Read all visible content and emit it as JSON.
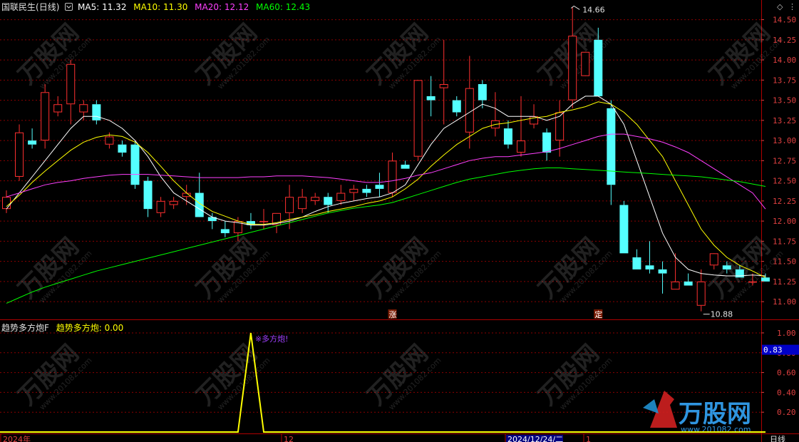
{
  "main_panel": {
    "stock_name": "国联民生",
    "period": "(日线)",
    "ma_legend": [
      {
        "label": "MA5: 11.32",
        "color": "#ffffff"
      },
      {
        "label": "MA10: 11.30",
        "color": "#ffff00"
      },
      {
        "label": "MA20: 12.12",
        "color": "#ff40ff"
      },
      {
        "label": "MA60: 12.43",
        "color": "#00ff00"
      }
    ],
    "high_marker": "14.66",
    "low_marker": "10.88",
    "markers": [
      {
        "text": "涨",
        "index": 30
      },
      {
        "text": "定",
        "index": 46
      }
    ],
    "colors": {
      "up": "#ff3030",
      "down": "#54ffff",
      "grid": "#8b0000",
      "axis_text": "#e04040"
    }
  },
  "sub_panel": {
    "name": "趋势多方炮F",
    "value_label": "趋势多方炮: 0.00",
    "signal_text": "※多方炮!",
    "current_marker": "0.83",
    "color": "#ffff00"
  },
  "x_axis": {
    "labels": [
      "2024年",
      "12",
      "2024/12/24/二",
      "1"
    ],
    "period_label": "日线"
  },
  "watermark": {
    "brand": "万股网",
    "url": "www.201082.com"
  },
  "chart_data": [
    {
      "type": "candlestick",
      "title": "国联民生 (日线)",
      "ylim": [
        10.78,
        14.62
      ],
      "y_ticks": [
        11.0,
        11.25,
        11.5,
        11.75,
        12.0,
        12.25,
        12.5,
        12.75,
        13.0,
        13.25,
        13.5,
        13.75,
        14.0,
        14.25,
        14.5
      ],
      "candles": [
        [
          12.15,
          12.38,
          12.1,
          12.3
        ],
        [
          12.55,
          13.2,
          12.5,
          13.1
        ],
        [
          13.0,
          13.15,
          12.9,
          12.95
        ],
        [
          13.0,
          13.7,
          12.9,
          13.6
        ],
        [
          13.35,
          13.55,
          13.3,
          13.45
        ],
        [
          13.45,
          14.0,
          13.2,
          13.95
        ],
        [
          13.35,
          13.5,
          13.25,
          13.45
        ],
        [
          13.45,
          13.5,
          13.2,
          13.25
        ],
        [
          12.95,
          13.1,
          12.9,
          13.05
        ],
        [
          12.95,
          13.0,
          12.8,
          12.85
        ],
        [
          12.95,
          13.0,
          12.4,
          12.45
        ],
        [
          12.5,
          12.55,
          12.05,
          12.15
        ],
        [
          12.1,
          12.3,
          12.05,
          12.25
        ],
        [
          12.2,
          12.3,
          12.15,
          12.25
        ],
        [
          12.3,
          12.45,
          12.2,
          12.35
        ],
        [
          12.35,
          12.6,
          12.15,
          12.05
        ],
        [
          12.05,
          12.1,
          11.9,
          12.0
        ],
        [
          11.9,
          12.0,
          11.8,
          11.85
        ],
        [
          11.85,
          12.05,
          11.75,
          12.0
        ],
        [
          12.0,
          12.1,
          11.9,
          11.95
        ],
        [
          12.0,
          12.15,
          11.9,
          12.0
        ],
        [
          11.95,
          12.1,
          11.85,
          12.1
        ],
        [
          12.1,
          12.45,
          11.9,
          12.3
        ],
        [
          12.15,
          12.4,
          12.1,
          12.3
        ],
        [
          12.25,
          12.35,
          12.2,
          12.3
        ],
        [
          12.3,
          12.35,
          12.1,
          12.2
        ],
        [
          12.25,
          12.45,
          12.2,
          12.35
        ],
        [
          12.35,
          12.45,
          12.25,
          12.4
        ],
        [
          12.4,
          12.45,
          12.3,
          12.35
        ],
        [
          12.45,
          12.6,
          12.3,
          12.4
        ],
        [
          12.35,
          12.85,
          12.3,
          12.75
        ],
        [
          12.7,
          12.75,
          12.65,
          12.65
        ],
        [
          12.8,
          13.75,
          12.75,
          13.75
        ],
        [
          13.55,
          13.8,
          13.3,
          13.5
        ],
        [
          13.65,
          14.25,
          13.2,
          13.7
        ],
        [
          13.5,
          13.55,
          13.3,
          13.35
        ],
        [
          13.1,
          14.05,
          12.9,
          13.65
        ],
        [
          13.7,
          13.75,
          13.4,
          13.5
        ],
        [
          13.15,
          13.6,
          13.05,
          13.25
        ],
        [
          13.15,
          13.25,
          12.9,
          12.95
        ],
        [
          12.85,
          13.55,
          12.8,
          13.0
        ],
        [
          13.2,
          13.45,
          13.15,
          13.3
        ],
        [
          13.1,
          13.15,
          12.75,
          12.85
        ],
        [
          13.0,
          13.5,
          12.8,
          13.35
        ],
        [
          13.5,
          14.66,
          13.4,
          14.3
        ],
        [
          13.8,
          14.0,
          13.85,
          14.1
        ],
        [
          14.25,
          14.4,
          13.55,
          13.55
        ],
        [
          13.4,
          13.5,
          12.2,
          12.45
        ],
        [
          12.2,
          12.25,
          11.6,
          11.6
        ],
        [
          11.55,
          11.65,
          11.4,
          11.4
        ],
        [
          11.45,
          11.75,
          11.35,
          11.4
        ],
        [
          11.4,
          11.5,
          11.1,
          11.35
        ],
        [
          11.15,
          11.6,
          11.15,
          11.25
        ],
        [
          11.25,
          11.35,
          11.2,
          11.2
        ],
        [
          10.95,
          11.4,
          10.88,
          11.25
        ],
        [
          11.45,
          11.55,
          11.4,
          11.6
        ],
        [
          11.45,
          11.5,
          11.35,
          11.4
        ],
        [
          11.4,
          11.45,
          11.3,
          11.3
        ],
        [
          11.25,
          11.35,
          11.2,
          11.25
        ],
        [
          11.3,
          11.35,
          11.25,
          11.25
        ]
      ],
      "series": [
        {
          "name": "MA5",
          "color": "#ffffff",
          "values": [
            12.15,
            12.35,
            12.55,
            12.75,
            12.95,
            13.15,
            13.3,
            13.3,
            13.25,
            13.15,
            13.0,
            12.8,
            12.55,
            12.35,
            12.25,
            12.15,
            12.05,
            12.0,
            11.98,
            11.95,
            11.95,
            11.97,
            12.0,
            12.05,
            12.12,
            12.18,
            12.22,
            12.25,
            12.28,
            12.3,
            12.35,
            12.45,
            12.7,
            12.95,
            13.15,
            13.25,
            13.35,
            13.45,
            13.4,
            13.3,
            13.3,
            13.3,
            13.25,
            13.3,
            13.45,
            13.55,
            13.55,
            13.45,
            13.2,
            12.75,
            12.3,
            11.85,
            11.55,
            11.4,
            11.35,
            11.33,
            11.32,
            11.32,
            11.33,
            11.32
          ]
        },
        {
          "name": "MA10",
          "color": "#ffff00",
          "values": [
            12.18,
            12.32,
            12.48,
            12.62,
            12.75,
            12.88,
            12.98,
            13.04,
            13.07,
            13.05,
            12.98,
            12.85,
            12.68,
            12.5,
            12.35,
            12.22,
            12.12,
            12.06,
            12.0,
            11.96,
            11.96,
            11.98,
            12.02,
            12.05,
            12.08,
            12.12,
            12.15,
            12.18,
            12.22,
            12.25,
            12.3,
            12.4,
            12.52,
            12.68,
            12.82,
            12.95,
            13.05,
            13.15,
            13.2,
            13.22,
            13.25,
            13.28,
            13.3,
            13.35,
            13.38,
            13.42,
            13.48,
            13.45,
            13.35,
            13.2,
            13.0,
            12.8,
            12.5,
            12.2,
            11.9,
            11.7,
            11.55,
            11.45,
            11.38,
            11.3
          ]
        },
        {
          "name": "MA20",
          "color": "#ff40ff",
          "values": [
            12.3,
            12.35,
            12.4,
            12.45,
            12.48,
            12.5,
            12.53,
            12.55,
            12.57,
            12.58,
            12.58,
            12.58,
            12.57,
            12.56,
            12.55,
            12.54,
            12.54,
            12.54,
            12.54,
            12.55,
            12.55,
            12.56,
            12.56,
            12.56,
            12.55,
            12.54,
            12.52,
            12.5,
            12.48,
            12.48,
            12.5,
            12.53,
            12.57,
            12.6,
            12.65,
            12.7,
            12.75,
            12.78,
            12.8,
            12.8,
            12.82,
            12.84,
            12.86,
            12.9,
            12.95,
            13.0,
            13.05,
            13.08,
            13.08,
            13.05,
            13.02,
            12.98,
            12.92,
            12.85,
            12.75,
            12.65,
            12.55,
            12.45,
            12.35,
            12.15
          ]
        },
        {
          "name": "MA60",
          "color": "#00ff00",
          "values": [
            10.98,
            11.05,
            11.12,
            11.18,
            11.23,
            11.28,
            11.33,
            11.38,
            11.42,
            11.46,
            11.5,
            11.54,
            11.58,
            11.62,
            11.66,
            11.7,
            11.74,
            11.78,
            11.82,
            11.86,
            11.9,
            11.94,
            11.98,
            12.02,
            12.06,
            12.1,
            12.13,
            12.16,
            12.18,
            12.2,
            12.23,
            12.28,
            12.33,
            12.38,
            12.43,
            12.48,
            12.52,
            12.55,
            12.58,
            12.61,
            12.63,
            12.65,
            12.66,
            12.66,
            12.65,
            12.64,
            12.63,
            12.62,
            12.61,
            12.6,
            12.59,
            12.58,
            12.57,
            12.56,
            12.55,
            12.53,
            12.51,
            12.49,
            12.46,
            12.43
          ]
        }
      ]
    },
    {
      "type": "line",
      "title": "趋势多方炮F",
      "ylim": [
        0,
        1.05
      ],
      "y_ticks": [
        0.2,
        0.4,
        0.6,
        0.8,
        1.0
      ],
      "series": [
        {
          "name": "趋势多方炮",
          "color": "#ffff00",
          "values": [
            0,
            0,
            0,
            0,
            0,
            0,
            0,
            0,
            0,
            0,
            0,
            0,
            0,
            0,
            0,
            0,
            0,
            0,
            0,
            1,
            0,
            0,
            0,
            0,
            0,
            0,
            0,
            0,
            0,
            0,
            0,
            0,
            0,
            0,
            0,
            0,
            0,
            0,
            0,
            0,
            0,
            0,
            0,
            0,
            0,
            0,
            0,
            0,
            0,
            0,
            0,
            0,
            0,
            0,
            0,
            0,
            0,
            0,
            0,
            0
          ]
        }
      ]
    }
  ]
}
